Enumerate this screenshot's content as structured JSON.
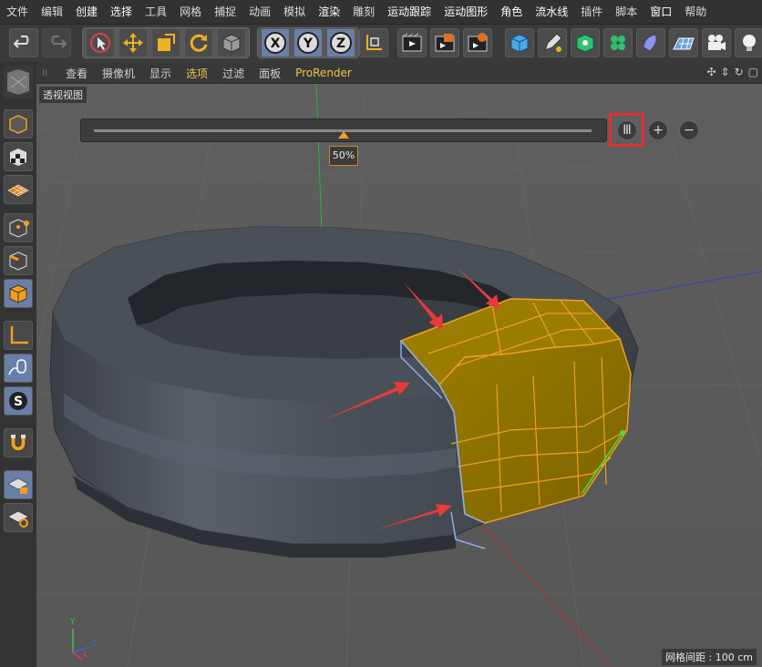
{
  "menubar": {
    "items": [
      {
        "label": "文件"
      },
      {
        "label": "编辑"
      },
      {
        "label": "创建"
      },
      {
        "label": "选择"
      },
      {
        "label": "工具"
      },
      {
        "label": "网格"
      },
      {
        "label": "捕捉"
      },
      {
        "label": "动画"
      },
      {
        "label": "模拟"
      },
      {
        "label": "渲染"
      },
      {
        "label": "雕刻"
      },
      {
        "label": "运动跟踪"
      },
      {
        "label": "运动图形"
      },
      {
        "label": "角色"
      },
      {
        "label": "流水线"
      },
      {
        "label": "插件"
      },
      {
        "label": "脚本"
      },
      {
        "label": "窗口"
      },
      {
        "label": "帮助"
      }
    ]
  },
  "toolbar": {
    "icons": [
      "undo-icon",
      "redo-icon",
      "live-selection-icon",
      "move-icon",
      "scale-icon",
      "rotate-icon",
      "object-mode-icon",
      "x-axis-icon",
      "y-axis-icon",
      "z-axis-icon",
      "coordinate-system-icon",
      "render-view-icon",
      "render-picture-viewer-icon",
      "render-settings-icon",
      "cube-icon",
      "pen-icon",
      "subdivision-icon",
      "cloner-icon",
      "deformer-icon",
      "floor-icon",
      "camera-icon",
      "light-icon"
    ]
  },
  "sidebar": {
    "icons": [
      "model-mode-icon",
      "texture-mode-icon",
      "workplane-icon",
      "points-mode-icon",
      "edges-mode-icon",
      "polygons-mode-icon",
      "axis-mode-icon",
      "tweak-mode-icon",
      "solo-mode-icon",
      "snap-magnet-icon",
      "lock-workplane-icon",
      "workplane-rotate-icon"
    ]
  },
  "viewport_menu": {
    "items": [
      {
        "label": "查看"
      },
      {
        "label": "摄像机"
      },
      {
        "label": "显示"
      },
      {
        "label": "选项"
      },
      {
        "label": "过滤"
      },
      {
        "label": "面板"
      },
      {
        "label": "ProRender"
      }
    ]
  },
  "viewport": {
    "label": "透视视图",
    "slider_value": "50%",
    "slider_fraction": 0.5,
    "grid_info": "网格间距 : 100 cm",
    "pause_symbol": "Ⅲ",
    "plus_symbol": "+",
    "minus_symbol": "−",
    "axis_x": "X",
    "axis_y": "Y",
    "axis_z": "Z"
  },
  "colors": {
    "accent": "#f2c14a",
    "selection": "#f0a020",
    "highlight_box": "#e03030"
  }
}
